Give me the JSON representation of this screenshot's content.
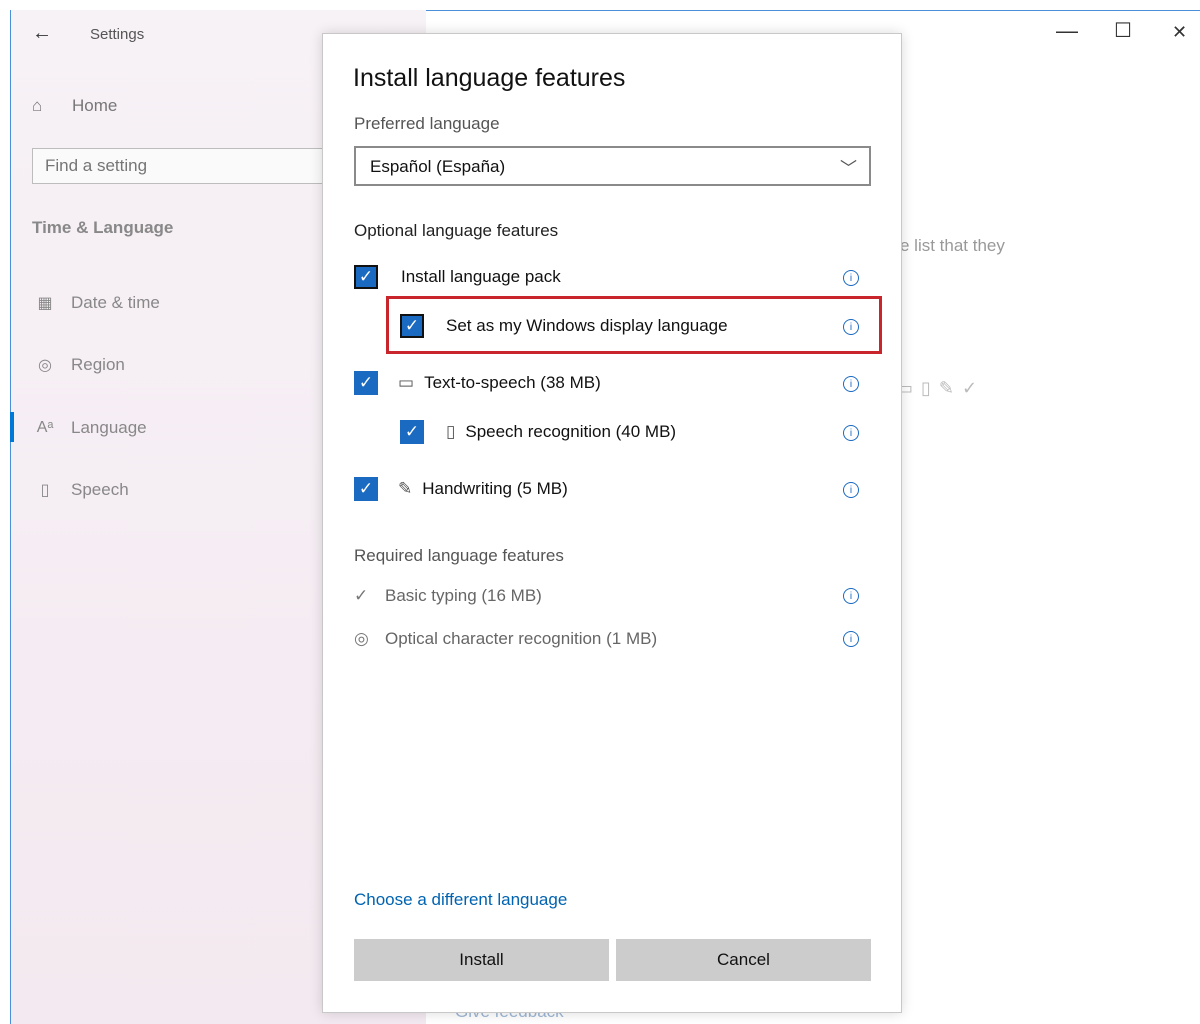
{
  "window": {
    "title": "Settings",
    "back_icon": "back-arrow-icon",
    "minimize_glyph": "—",
    "maximize_glyph": "☐",
    "close_glyph": "✕"
  },
  "sidebar": {
    "home_label": "Home",
    "search_placeholder": "Find a setting",
    "section_title": "Time & Language",
    "items": [
      {
        "label": "Date & time",
        "icon": "calendar-clock-icon"
      },
      {
        "label": "Region",
        "icon": "globe-icon"
      },
      {
        "label": "Language",
        "icon": "language-icon"
      },
      {
        "label": "Speech",
        "icon": "microphone-icon"
      }
    ],
    "selected_index": 2
  },
  "background": {
    "partial_text": "e list that they",
    "feedback_text": "Give feedback"
  },
  "dialog": {
    "title": "Install language features",
    "preferred_label": "Preferred language",
    "preferred_value": "Español (España)",
    "optional_label": "Optional language features",
    "optional_features": [
      {
        "label": "Install language pack",
        "checked": true,
        "icon": ""
      },
      {
        "label": "Set as my Windows display language",
        "checked": true,
        "icon": ""
      },
      {
        "label": "Text-to-speech (38 MB)",
        "checked": true,
        "icon": "text-to-speech-icon"
      },
      {
        "label": "Speech recognition (40 MB)",
        "checked": true,
        "icon": "microphone-icon"
      },
      {
        "label": "Handwriting (5 MB)",
        "checked": true,
        "icon": "handwriting-icon"
      }
    ],
    "required_label": "Required language features",
    "required_features": [
      {
        "label": "Basic typing (16 MB)",
        "icon": "basic-typing-icon"
      },
      {
        "label": "Optical character recognition (1 MB)",
        "icon": "ocr-icon"
      }
    ],
    "choose_link": "Choose a different language",
    "install_label": "Install",
    "cancel_label": "Cancel"
  },
  "colors": {
    "accent": "#1a6ac2",
    "highlight": "#c9252c",
    "button": "#cccccc"
  }
}
